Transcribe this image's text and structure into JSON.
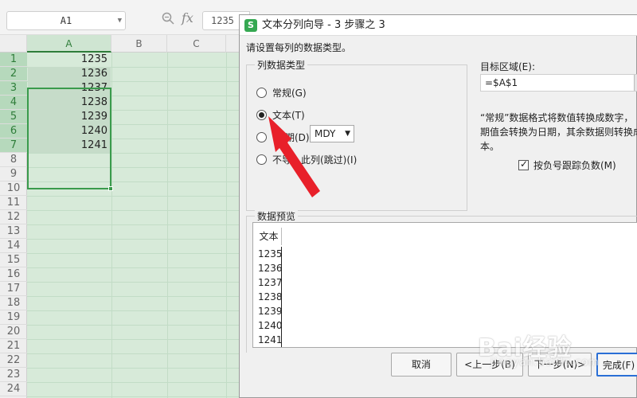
{
  "formula_bar": {
    "name_box": "A1",
    "formula_value": "1235",
    "fx_label": "fx"
  },
  "sheet": {
    "columns": [
      "A",
      "B",
      "C"
    ],
    "rows": [
      "1",
      "2",
      "3",
      "4",
      "5",
      "6",
      "7",
      "8",
      "9",
      "10",
      "11",
      "12",
      "13",
      "14",
      "15",
      "16",
      "17",
      "18",
      "19",
      "20",
      "21",
      "22",
      "23",
      "24"
    ],
    "cells_a": [
      "1235",
      "1236",
      "1237",
      "1238",
      "1239",
      "1240",
      "1241"
    ]
  },
  "dialog": {
    "icon_letter": "S",
    "title": "文本分列向导 - 3 步骤之 3",
    "instruction": "请设置每列的数据类型。",
    "column_type_legend": "列数据类型",
    "options": {
      "general": "常规(G)",
      "text": "文本(T)",
      "date": "期(D)",
      "skip": "不导入此列(跳过)(I)"
    },
    "date_format": "MDY",
    "dest_label": "目标区域(E):",
    "dest_value": "=$A$1",
    "description_lines": [
      "“常规”数据格式将数值转换成数字，",
      "期值会转换为日期，其余数据则转换成",
      "本。"
    ],
    "checkbox_label": "按负号跟踪负数(M)",
    "preview_legend": "数据预览",
    "preview_header": "文本",
    "preview_values": [
      "1235",
      "1236",
      "1237",
      "1238",
      "1239",
      "1240",
      "1241"
    ],
    "buttons": {
      "cancel": "取消",
      "back": "<上一步(B)",
      "next": "下一步(N)>",
      "finish": "完成(F)"
    }
  },
  "watermark": {
    "main": "Bai经验",
    "sub": "jingyan.baidu.com"
  },
  "colors": {
    "selection": "#3a9b4c",
    "arrow": "#e8202a",
    "primary_button": "#2a6fd6"
  }
}
